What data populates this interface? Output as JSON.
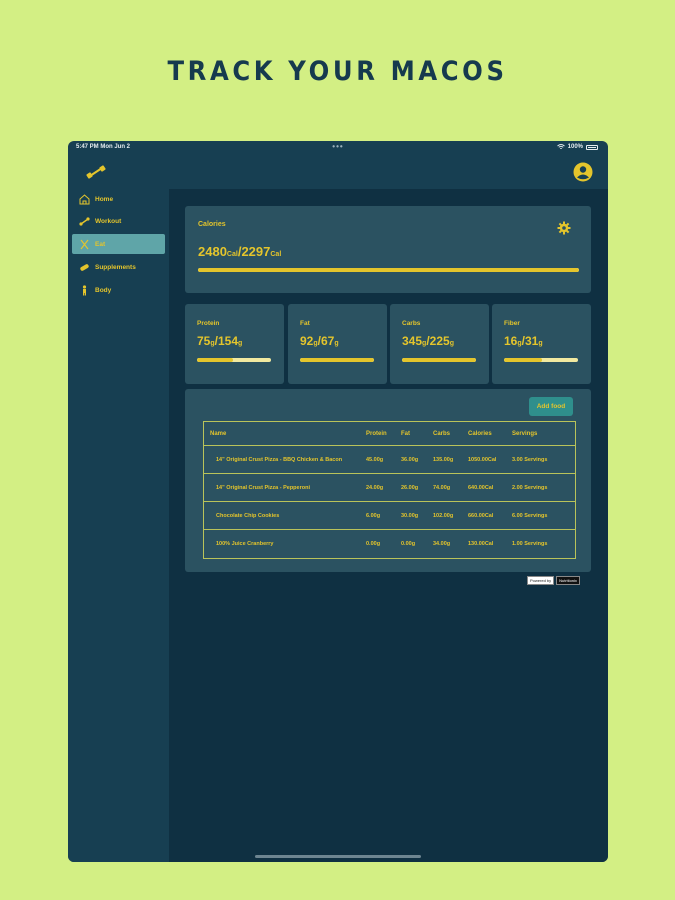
{
  "headline": "TRACK YOUR MACOS",
  "status": {
    "time": "5:47 PM  Mon Jun 2",
    "battery": "100%"
  },
  "nav": [
    {
      "label": "Home",
      "icon": "home-icon"
    },
    {
      "label": "Workout",
      "icon": "dumbbell-icon"
    },
    {
      "label": "Eat",
      "icon": "fork-knife-icon"
    },
    {
      "label": "Supplements",
      "icon": "pill-icon"
    },
    {
      "label": "Body",
      "icon": "person-icon"
    }
  ],
  "active_nav": "Eat",
  "calories": {
    "label": "Calories",
    "consumed": "2480",
    "goal": "2297",
    "unit": "Cal",
    "fraction": 1.0
  },
  "macros": [
    {
      "label": "Protein",
      "consumed": "75",
      "goal": "154",
      "unit": "g",
      "fraction": 0.49
    },
    {
      "label": "Fat",
      "consumed": "92",
      "goal": "67",
      "unit": "g",
      "fraction": 1.0
    },
    {
      "label": "Carbs",
      "consumed": "345",
      "goal": "225",
      "unit": "g",
      "fraction": 1.0
    },
    {
      "label": "Fiber",
      "consumed": "16",
      "goal": "31",
      "unit": "g",
      "fraction": 0.52
    }
  ],
  "food": {
    "add_label": "Add food",
    "headers": {
      "name": "Name",
      "protein": "Protein",
      "fat": "Fat",
      "carbs": "Carbs",
      "calories": "Calories",
      "servings": "Servings"
    },
    "rows": [
      {
        "name": "14\" Original Crust Pizza - BBQ Chicken & Bacon",
        "protein": "45.00g",
        "fat": "36.00g",
        "carbs": "135.00g",
        "calories": "1050.00Cal",
        "servings": "3.00 Servings"
      },
      {
        "name": "14\" Original Crust Pizza - Pepperoni",
        "protein": "24.00g",
        "fat": "26.00g",
        "carbs": "74.00g",
        "calories": "640.00Cal",
        "servings": "2.00 Servings"
      },
      {
        "name": "Chocolate Chip Cookies",
        "protein": "6.00g",
        "fat": "30.00g",
        "carbs": "102.00g",
        "calories": "660.00Cal",
        "servings": "6.00 Servings"
      },
      {
        "name": "100% Juice Cranberry",
        "protein": "0.00g",
        "fat": "0.00g",
        "carbs": "34.00g",
        "calories": "130.00Cal",
        "servings": "1.00 Servings"
      }
    ]
  },
  "powered": {
    "left": "Powered by",
    "right": "Nutritionix"
  },
  "colors": {
    "background": "#d3ef84",
    "panel": "#2b5261",
    "accent": "#e4c52c",
    "active_nav": "#5fa5a8"
  }
}
